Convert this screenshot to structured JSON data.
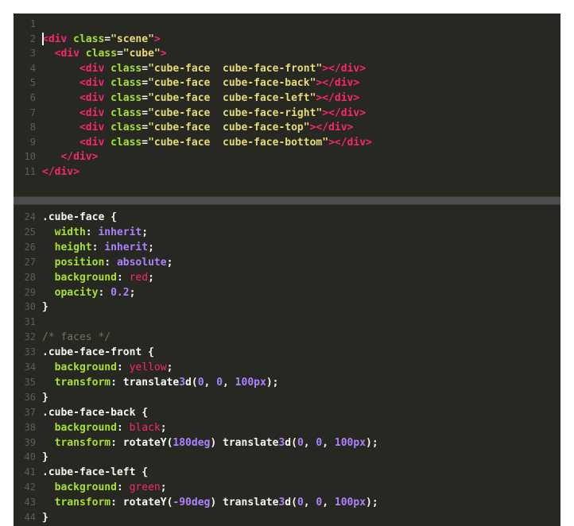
{
  "editor": {
    "theme": "monokai",
    "colors": {
      "background": "#272822",
      "tag": "#f92672",
      "attribute": "#a6e22e",
      "string": "#e6db74",
      "value": "#ae81ff",
      "comment": "#75715e",
      "line_number": "#5e5e58"
    },
    "html_pane": {
      "lines": [
        {
          "num": "1",
          "code": ""
        },
        {
          "num": "2",
          "code": "<div class=\"scene\">"
        },
        {
          "num": "3",
          "code": "  <div class=\"cube\">"
        },
        {
          "num": "4",
          "code": "      <div class=\"cube-face  cube-face-front\"></div>"
        },
        {
          "num": "5",
          "code": "      <div class=\"cube-face  cube-face-back\"></div>"
        },
        {
          "num": "6",
          "code": "      <div class=\"cube-face  cube-face-left\"></div>"
        },
        {
          "num": "7",
          "code": "      <div class=\"cube-face  cube-face-right\"></div>"
        },
        {
          "num": "8",
          "code": "      <div class=\"cube-face  cube-face-top\"></div>"
        },
        {
          "num": "9",
          "code": "      <div class=\"cube-face  cube-face-bottom\"></div>"
        },
        {
          "num": "10",
          "code": "   </div>"
        },
        {
          "num": "11",
          "code": "</div>"
        }
      ]
    },
    "css_pane": {
      "lines": [
        {
          "num": "24",
          "code": ".cube-face {"
        },
        {
          "num": "25",
          "code": "  width: inherit;"
        },
        {
          "num": "26",
          "code": "  height: inherit;"
        },
        {
          "num": "27",
          "code": "  position: absolute;"
        },
        {
          "num": "28",
          "code": "  background: red;"
        },
        {
          "num": "29",
          "code": "  opacity: 0.2;"
        },
        {
          "num": "30",
          "code": "}"
        },
        {
          "num": "31",
          "code": ""
        },
        {
          "num": "32",
          "code": "/* faces */"
        },
        {
          "num": "33",
          "code": ".cube-face-front {"
        },
        {
          "num": "34",
          "code": "  background: yellow;"
        },
        {
          "num": "35",
          "code": "  transform: translate3d(0, 0, 100px);"
        },
        {
          "num": "36",
          "code": "}"
        },
        {
          "num": "37",
          "code": ".cube-face-back {"
        },
        {
          "num": "38",
          "code": "  background: black;"
        },
        {
          "num": "39",
          "code": "  transform: rotateY(180deg) translate3d(0, 0, 100px);"
        },
        {
          "num": "40",
          "code": "}"
        },
        {
          "num": "41",
          "code": ".cube-face-left {"
        },
        {
          "num": "42",
          "code": "  background: green;"
        },
        {
          "num": "43",
          "code": "  transform: rotateY(-90deg) translate3d(0, 0, 100px);"
        },
        {
          "num": "44",
          "code": "}"
        }
      ]
    }
  }
}
